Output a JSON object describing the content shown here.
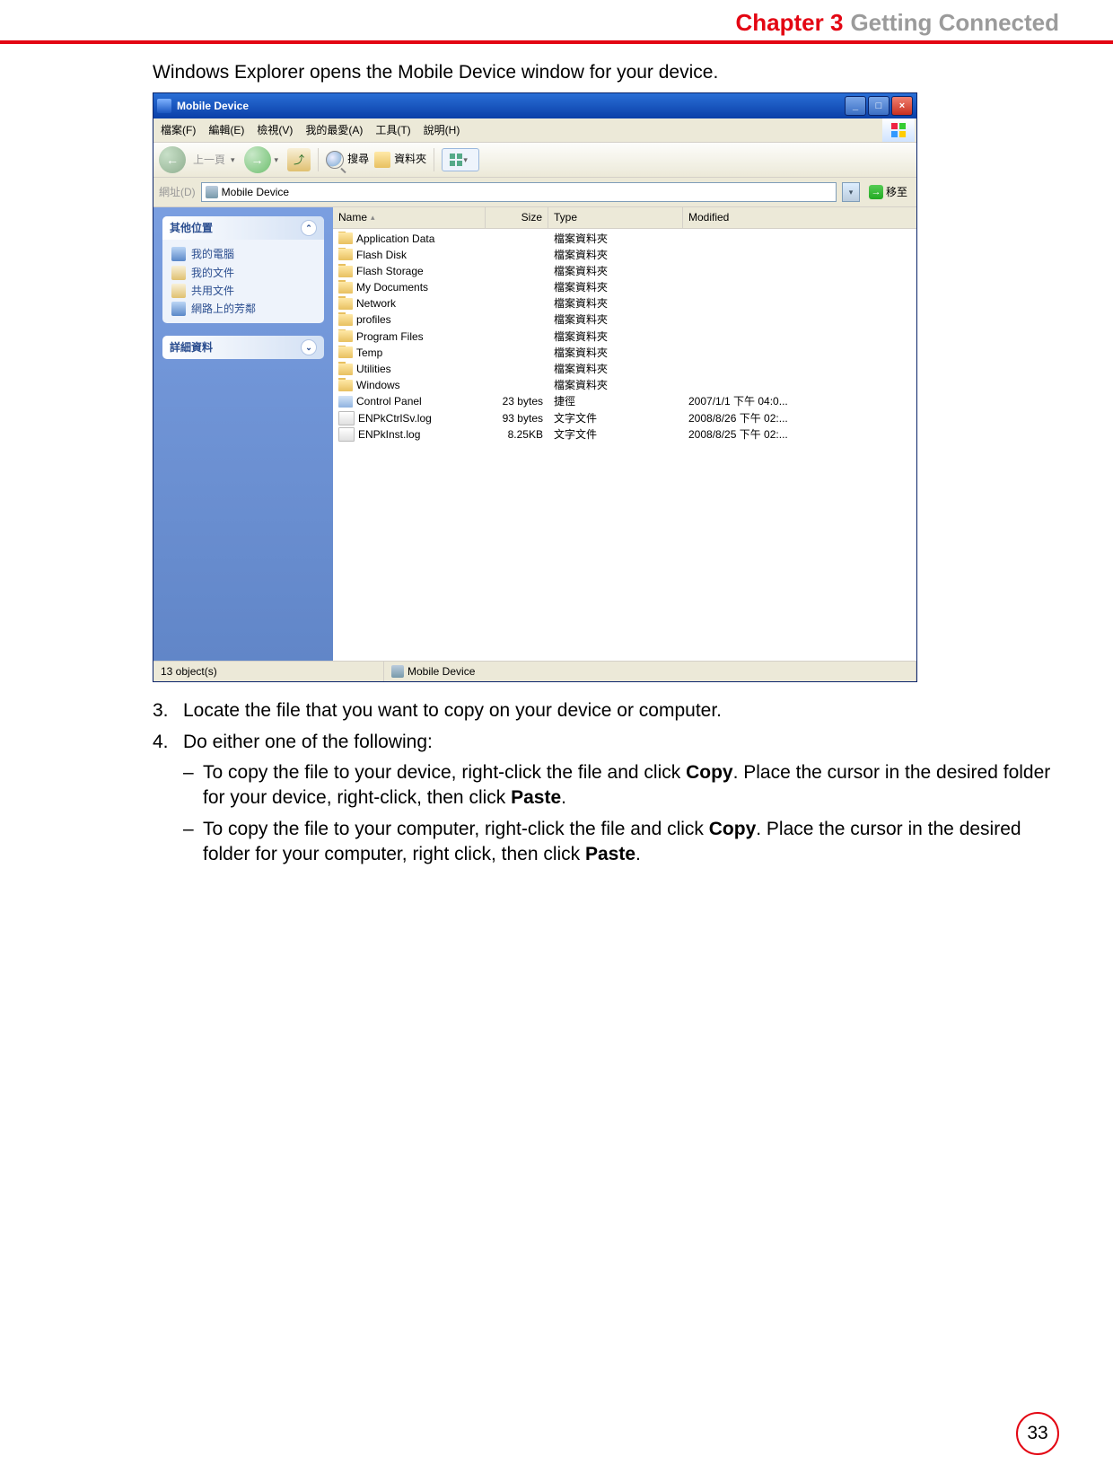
{
  "header": {
    "chapter": "Chapter 3",
    "title": "Getting Connected"
  },
  "intro": "Windows Explorer opens the Mobile Device window for your device.",
  "screenshot": {
    "window_title": "Mobile Device",
    "menu": [
      "檔案(F)",
      "編輯(E)",
      "檢視(V)",
      "我的最愛(A)",
      "工具(T)",
      "說明(H)"
    ],
    "toolbar": {
      "back_label": "上一頁",
      "search_label": "搜尋",
      "folders_label": "資料夾"
    },
    "address": {
      "label": "網址(D)",
      "value": "Mobile Device",
      "go_label": "移至"
    },
    "sidebar": {
      "panel1_title": "其他位置",
      "panel1_items": [
        {
          "icon": "pc",
          "label": "我的電腦"
        },
        {
          "icon": "doc",
          "label": "我的文件"
        },
        {
          "icon": "share",
          "label": "共用文件"
        },
        {
          "icon": "net",
          "label": "網路上的芳鄰"
        }
      ],
      "panel2_title": "詳細資料"
    },
    "columns": {
      "name": "Name",
      "size": "Size",
      "type": "Type",
      "modified": "Modified"
    },
    "rows": [
      {
        "icon": "folder",
        "name": "Application Data",
        "size": "",
        "type": "檔案資料夾",
        "modified": ""
      },
      {
        "icon": "folder",
        "name": "Flash Disk",
        "size": "",
        "type": "檔案資料夾",
        "modified": ""
      },
      {
        "icon": "folder",
        "name": "Flash Storage",
        "size": "",
        "type": "檔案資料夾",
        "modified": ""
      },
      {
        "icon": "folder",
        "name": "My Documents",
        "size": "",
        "type": "檔案資料夾",
        "modified": ""
      },
      {
        "icon": "folder",
        "name": "Network",
        "size": "",
        "type": "檔案資料夾",
        "modified": ""
      },
      {
        "icon": "folder",
        "name": "profiles",
        "size": "",
        "type": "檔案資料夾",
        "modified": ""
      },
      {
        "icon": "folder",
        "name": "Program Files",
        "size": "",
        "type": "檔案資料夾",
        "modified": ""
      },
      {
        "icon": "folder",
        "name": "Temp",
        "size": "",
        "type": "檔案資料夾",
        "modified": ""
      },
      {
        "icon": "folder",
        "name": "Utilities",
        "size": "",
        "type": "檔案資料夾",
        "modified": ""
      },
      {
        "icon": "folder",
        "name": "Windows",
        "size": "",
        "type": "檔案資料夾",
        "modified": ""
      },
      {
        "icon": "cpl",
        "name": "Control Panel",
        "size": "23 bytes",
        "type": "捷徑",
        "modified": "2007/1/1 下午 04:0..."
      },
      {
        "icon": "file",
        "name": "ENPkCtrlSv.log",
        "size": "93 bytes",
        "type": "文字文件",
        "modified": "2008/8/26 下午 02:..."
      },
      {
        "icon": "file",
        "name": "ENPkInst.log",
        "size": "8.25KB",
        "type": "文字文件",
        "modified": "2008/8/25 下午 02:..."
      }
    ],
    "status": {
      "left": "13 object(s)",
      "mid": "Mobile Device"
    }
  },
  "steps": {
    "s3_num": "3.",
    "s3": "Locate the file that you want to copy on your device or computer.",
    "s4_num": "4.",
    "s4": "Do either one of the following:",
    "b1a": "To copy the file to your device, right-click the file and click ",
    "b1b": "Copy",
    "b1c": ". Place the cursor in the desired folder for your device, right-click, then click ",
    "b1d": "Paste",
    "b1e": ".",
    "b2a": "To copy the file to your computer, right-click the file and click ",
    "b2b": "Copy",
    "b2c": ". Place the cursor in the desired folder for your computer, right click, then click ",
    "b2d": "Paste",
    "b2e": "."
  },
  "page_number": "33"
}
